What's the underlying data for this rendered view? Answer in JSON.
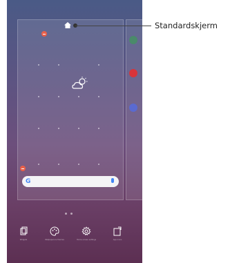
{
  "callout": {
    "label": "Standardskjerm"
  },
  "home_screen_edit": {
    "edit_options": [
      {
        "icon": "widgets-icon",
        "label": "Widgets"
      },
      {
        "icon": "wallpaper-icon",
        "label": "Wallpapers & themes"
      },
      {
        "icon": "settings-icon",
        "label": "Home screen settings"
      },
      {
        "icon": "app-icons-icon",
        "label": "App icons"
      }
    ],
    "search_widget": {
      "logo": "G"
    }
  },
  "colors": {
    "remove_badge": "#e8604a",
    "wallpaper_top": "#4a5a86",
    "wallpaper_bottom": "#5c2f52",
    "google_blue": "#4285f4"
  }
}
